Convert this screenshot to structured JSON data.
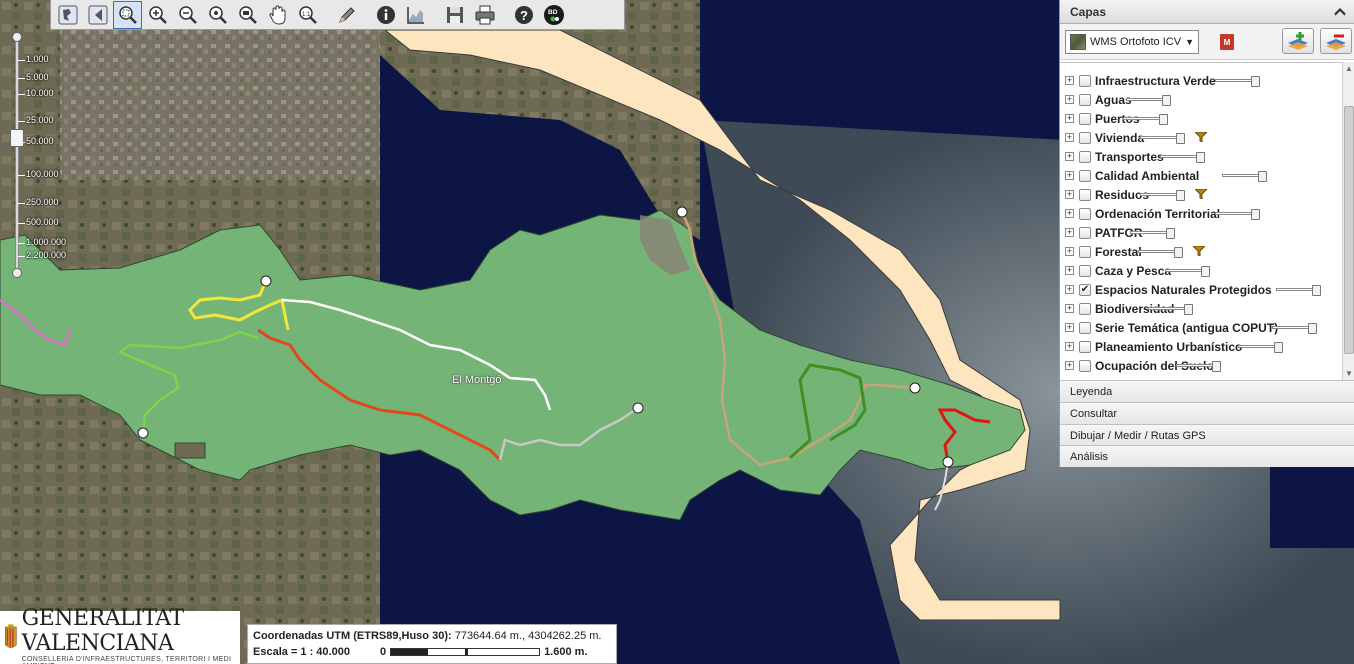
{
  "map": {
    "place_label": "El Montgó"
  },
  "toolbar": {
    "tools": [
      {
        "id": "full-extent",
        "icon": "globe-icon"
      },
      {
        "id": "previous-extent",
        "icon": "back-arrow-icon"
      },
      {
        "id": "zoom-box",
        "icon": "zoom-box-icon"
      },
      {
        "id": "zoom-in",
        "icon": "zoom-in-icon"
      },
      {
        "id": "zoom-out",
        "icon": "zoom-out-icon"
      },
      {
        "id": "zoom-center",
        "icon": "zoom-center-icon"
      },
      {
        "id": "zoom-layer",
        "icon": "zoom-layer-icon"
      },
      {
        "id": "pan",
        "icon": "hand-icon"
      },
      {
        "id": "zoom-scale",
        "icon": "scale-icon"
      },
      {
        "id": "measure",
        "icon": "pencil-icon"
      },
      {
        "id": "info",
        "icon": "info-icon"
      },
      {
        "id": "profile",
        "icon": "profile-chart-icon"
      },
      {
        "id": "save",
        "icon": "save-icon"
      },
      {
        "id": "print",
        "icon": "print-icon"
      },
      {
        "id": "help",
        "icon": "help-icon"
      },
      {
        "id": "bdd",
        "icon": "bdd-icon"
      }
    ]
  },
  "zoom_scale": {
    "labels": [
      "1.000",
      "5.000",
      "10.000",
      "25.000",
      "50.000",
      "100.000",
      "250.000",
      "500.000",
      "1.000.000",
      "2.200.000"
    ]
  },
  "panel": {
    "title": "Capas",
    "basemap": "WMS Ortofoto ICV",
    "layers": [
      {
        "name": "Infraestructura Verde",
        "checked": false,
        "filter": false
      },
      {
        "name": "Aguas",
        "checked": false,
        "filter": false
      },
      {
        "name": "Puertos",
        "checked": false,
        "filter": false
      },
      {
        "name": "Vivienda",
        "checked": false,
        "filter": true
      },
      {
        "name": "Transportes",
        "checked": false,
        "filter": false
      },
      {
        "name": "Calidad Ambiental",
        "checked": false,
        "filter": false
      },
      {
        "name": "Residuos",
        "checked": false,
        "filter": true
      },
      {
        "name": "Ordenación Territorial",
        "checked": false,
        "filter": false
      },
      {
        "name": "PATFOR",
        "checked": false,
        "filter": false
      },
      {
        "name": "Forestal",
        "checked": false,
        "filter": true
      },
      {
        "name": "Caza y Pesca",
        "checked": false,
        "filter": false
      },
      {
        "name": "Espacios Naturales Protegidos",
        "checked": true,
        "filter": false
      },
      {
        "name": "Biodiversidad",
        "checked": false,
        "filter": false
      },
      {
        "name": "Serie Temática (antigua COPUT)",
        "checked": false,
        "filter": false
      },
      {
        "name": "Planeamiento Urbanístico",
        "checked": false,
        "filter": false
      },
      {
        "name": "Ocupación del Suelo",
        "checked": false,
        "filter": false
      }
    ],
    "sections": [
      "Leyenda",
      "Consultar",
      "Dibujar / Medir / Rutas GPS",
      "Análisis"
    ]
  },
  "footer": {
    "logo_title": "GENERALITAT VALENCIANA",
    "logo_subtitle": "CONSELLERIA D'INFRAESTRUCTURES, TERRITORI I MEDI AMBIENT",
    "coords_label": "Coordenadas UTM (ETRS89,Huso 30):",
    "coords_value": "773644.64 m., 4304262.25 m.",
    "scale_label": "Escala = 1 : 40.000",
    "scalebar_start": "0",
    "scalebar_end": "1.600 m."
  },
  "colors": {
    "protected_area": "#74b477",
    "sea": "#0d1545",
    "shore": "#fde6bf",
    "route_pink": "#e06fc9",
    "route_green_light": "#7fd44b",
    "route_yellow": "#f2e63a",
    "route_white": "#ffffff",
    "route_orange": "#e2481c",
    "route_gray": "#c8c8c8",
    "route_tan": "#c9a47a",
    "route_dark_green": "#3f8f23",
    "route_red": "#e01515"
  }
}
